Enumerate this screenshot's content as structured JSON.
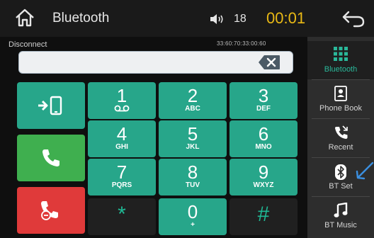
{
  "header": {
    "title": "Bluetooth",
    "volume_level": "18",
    "clock": "00:01"
  },
  "call": {
    "status": "Disconnect",
    "device_address": "33:60:70:33:00:60",
    "number_value": ""
  },
  "keypad": [
    {
      "digit": "1",
      "letters": ""
    },
    {
      "digit": "2",
      "letters": "ABC"
    },
    {
      "digit": "3",
      "letters": "DEF"
    },
    {
      "digit": "4",
      "letters": "GHI"
    },
    {
      "digit": "5",
      "letters": "JKL"
    },
    {
      "digit": "6",
      "letters": "MNO"
    },
    {
      "digit": "7",
      "letters": "PQRS"
    },
    {
      "digit": "8",
      "letters": "TUV"
    },
    {
      "digit": "9",
      "letters": "WXYZ"
    },
    {
      "digit": "*",
      "letters": ""
    },
    {
      "digit": "0",
      "letters": "+"
    },
    {
      "digit": "#",
      "letters": ""
    }
  ],
  "actions": {
    "transfer_icon": "phone-transfer-icon",
    "call_icon": "call-icon",
    "hangup_icon": "hangup-icon"
  },
  "sidebar": [
    {
      "label": "Bluetooth",
      "icon": "keypad-grid-icon",
      "active": true
    },
    {
      "label": "Phone Book",
      "icon": "contacts-icon",
      "active": false
    },
    {
      "label": "Recent",
      "icon": "recent-calls-icon",
      "active": false
    },
    {
      "label": "BT Set",
      "icon": "bluetooth-icon",
      "active": false
    },
    {
      "label": "BT Music",
      "icon": "music-note-icon",
      "active": false
    }
  ],
  "colors": {
    "accent_teal": "#27a68a",
    "call_green": "#3faf4f",
    "hangup_red": "#e03a3a",
    "clock_yellow": "#e9b915"
  }
}
